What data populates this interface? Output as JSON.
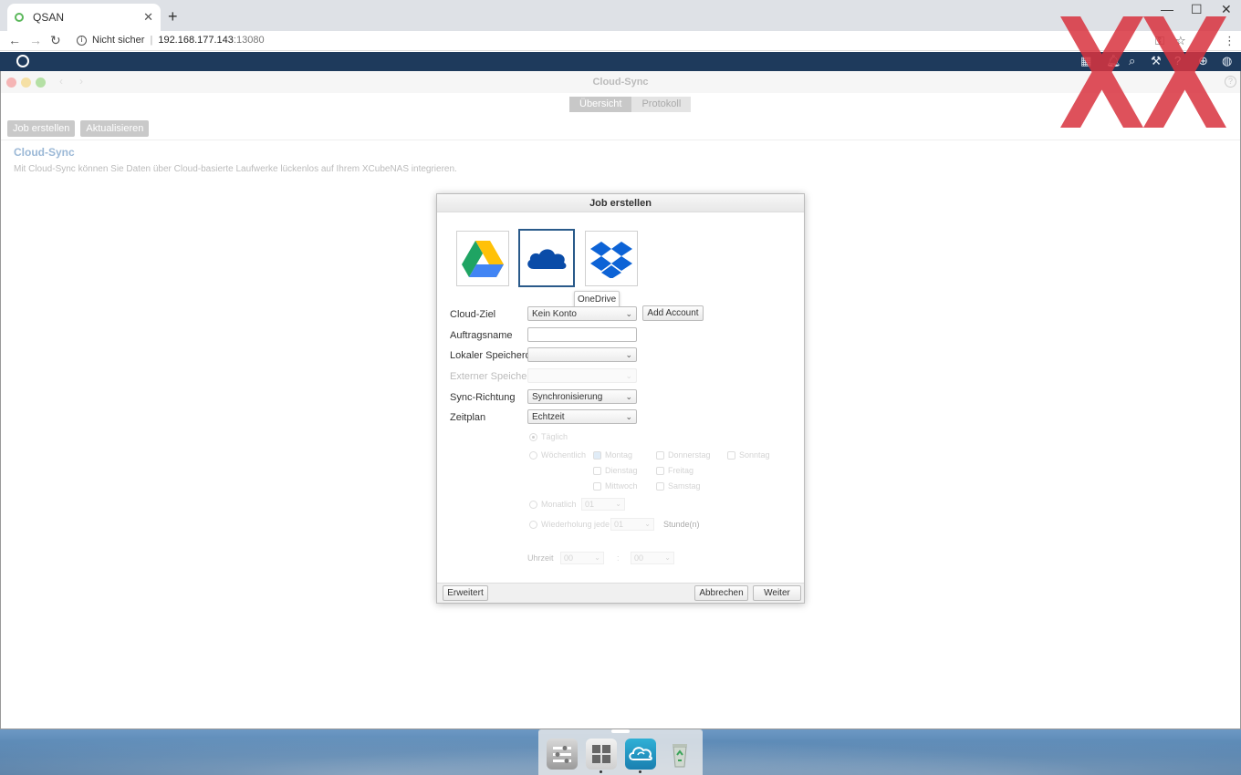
{
  "browser": {
    "tab_title": "QSAN",
    "url_info": "Nicht sicher",
    "url_host": "192.168.177.143",
    "url_port": ":13080"
  },
  "app": {
    "title": "Cloud-Sync",
    "tabs": [
      {
        "label": "Übersicht",
        "active": true
      },
      {
        "label": "Protokoll",
        "active": false
      }
    ],
    "toolbar": {
      "create_job": "Job erstellen",
      "refresh": "Aktualisieren"
    },
    "section_title": "Cloud-Sync",
    "section_desc": "Mit Cloud-Sync können Sie Daten über Cloud-basierte Laufwerke lückenlos auf Ihrem XCubeNAS integrieren."
  },
  "dialog": {
    "title": "Job erstellen",
    "providers": [
      {
        "name": "google-drive",
        "icon": "google-drive-icon",
        "selected": false
      },
      {
        "name": "onedrive",
        "icon": "onedrive-icon",
        "selected": true
      },
      {
        "name": "dropbox",
        "icon": "dropbox-icon",
        "selected": false
      }
    ],
    "tooltip": "OneDrive",
    "fields": {
      "cloud_target_label": "Cloud-Ziel",
      "cloud_target_value": "Kein Konto",
      "add_account": "Add Account",
      "job_name_label": "Auftragsname",
      "local_location_label": "Lokaler Speicherort",
      "local_location_value": "",
      "external_location_label": "Externer Speicherort",
      "sync_direction_label": "Sync-Richtung",
      "sync_direction_value": "Synchronisierung",
      "schedule_label": "Zeitplan",
      "schedule_value": "Echtzeit"
    },
    "schedule_options": {
      "daily": "Täglich",
      "weekly": "Wöchentlich",
      "days": [
        "Montag",
        "Donnerstag",
        "Sonntag",
        "Dienstag",
        "Freitag",
        "Mittwoch",
        "Samstag"
      ],
      "monthly": "Monatlich",
      "monthly_value": "01",
      "repeat_every": "Wiederholung jede",
      "repeat_value": "01",
      "hours_unit": "Stunde(n)",
      "time_label": "Uhrzeit",
      "time_hour": "00",
      "time_sep": ":",
      "time_min": "00"
    },
    "footer": {
      "advanced": "Erweitert",
      "cancel": "Abbrechen",
      "next": "Weiter"
    }
  },
  "colors": {
    "nas_header": "#1e3a5c",
    "accent": "#2a5a8a",
    "watermark": "#d9333f"
  }
}
